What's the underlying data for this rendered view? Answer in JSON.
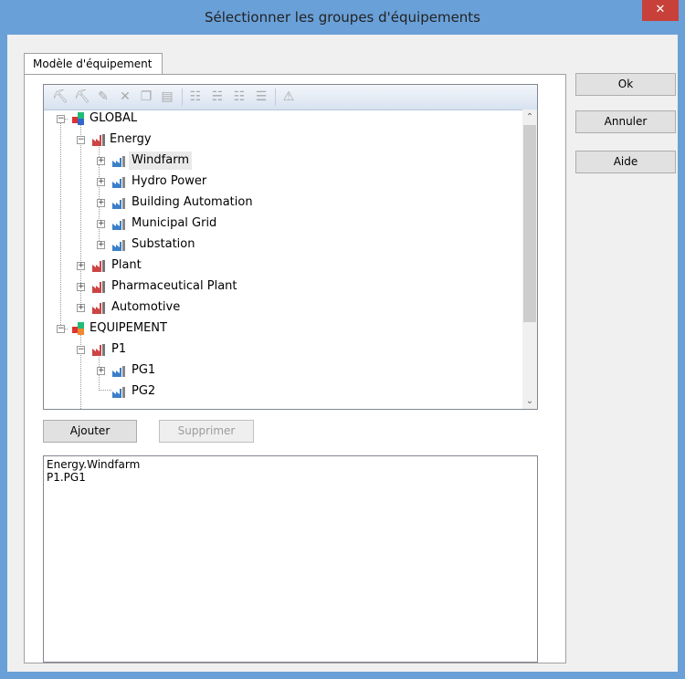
{
  "window": {
    "title": "Sélectionner les groupes d'équipements",
    "close_glyph": "✕"
  },
  "tab": {
    "label": "Modèle d'équipement"
  },
  "toolbar": {
    "icons": [
      "add-group-icon",
      "add-subgroup-icon",
      "edit-icon",
      "delete-icon",
      "copy-icon",
      "paste-icon",
      "expand-all-icon",
      "collapse-all-icon",
      "expand-level-icon",
      "collapse-level-icon",
      "warning-icon"
    ]
  },
  "tree": {
    "nodes": [
      {
        "label": "GLOBAL",
        "expander": "−"
      },
      {
        "label": "Energy",
        "expander": "−"
      },
      {
        "label": "Windfarm",
        "expander": "+"
      },
      {
        "label": "Hydro Power",
        "expander": "+"
      },
      {
        "label": "Building Automation",
        "expander": "+"
      },
      {
        "label": "Municipal Grid",
        "expander": "+"
      },
      {
        "label": "Substation",
        "expander": "+"
      },
      {
        "label": "Plant",
        "expander": "+"
      },
      {
        "label": "Pharmaceutical Plant",
        "expander": "+"
      },
      {
        "label": "Automotive",
        "expander": "+"
      },
      {
        "label": "EQUIPEMENT",
        "expander": "−"
      },
      {
        "label": "P1",
        "expander": "−"
      },
      {
        "label": "PG1",
        "expander": "+"
      },
      {
        "label": "PG2",
        "expander": ""
      }
    ],
    "selected": "Windfarm"
  },
  "scrollbar": {
    "up_glyph": "⌃",
    "down_glyph": "⌄"
  },
  "actions": {
    "add_label": "Ajouter",
    "remove_label": "Supprimer"
  },
  "selection_list": {
    "items": [
      "Energy.Windfarm",
      "P1.PG1"
    ]
  },
  "dialog_buttons": {
    "ok_label": "Ok",
    "cancel_label": "Annuler",
    "help_label": "Aide"
  },
  "colors": {
    "title_bar": "#6aa0d8",
    "close_button": "#c7413a",
    "dialog_bg": "#f0f0f0"
  }
}
